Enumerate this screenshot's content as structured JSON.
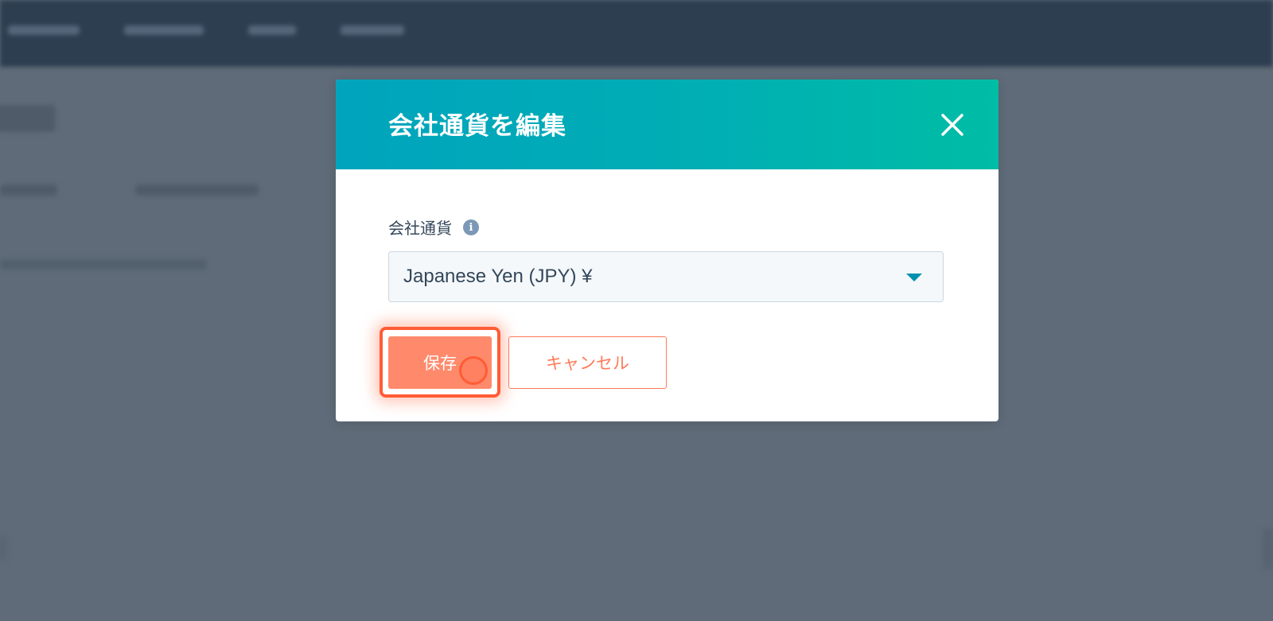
{
  "modal": {
    "title": "会社通貨を編集",
    "field_label": "会社通貨",
    "info_icon_glyph": "i",
    "select_value": "Japanese Yen (JPY) ¥",
    "save_label": "保存",
    "cancel_label": "キャンセル"
  },
  "icons": {
    "close": "close-icon",
    "info": "info-icon",
    "dropdown": "caret-down-icon"
  },
  "colors": {
    "header_gradient_start": "#00a4bd",
    "header_gradient_end": "#00bda5",
    "primary_button": "#ff8a6b",
    "accent_orange": "#ff5c35",
    "cancel_text": "#ff7a59",
    "overlay": "#5f6b78"
  }
}
